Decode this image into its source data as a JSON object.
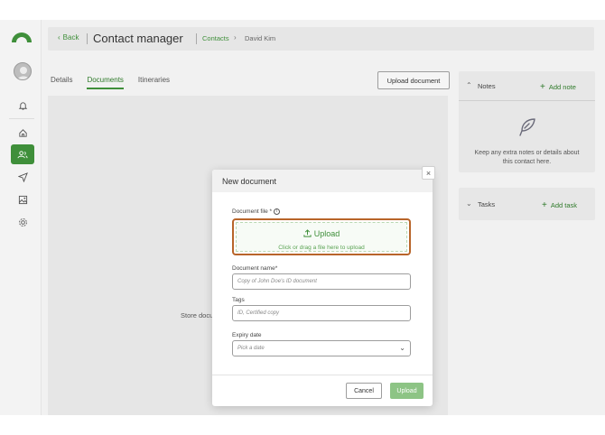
{
  "header": {
    "back_label": "Back",
    "title": "Contact manager",
    "breadcrumb": [
      "Contacts",
      "David Kim"
    ]
  },
  "tabs": [
    "Details",
    "Documents",
    "Itineraries"
  ],
  "active_tab": "Documents",
  "toolbar": {
    "upload_document_label": "Upload document"
  },
  "content": {
    "empty_text_visible": "Store docu"
  },
  "notes": {
    "title": "Notes",
    "add_label": "Add note",
    "empty_text": "Keep any extra notes or details about this contact here."
  },
  "tasks": {
    "title": "Tasks",
    "add_label": "Add task"
  },
  "sidebar": {
    "icons": [
      "logo",
      "avatar",
      "bell-icon",
      "home-icon",
      "contacts-icon",
      "send-icon",
      "image-icon",
      "settings-icon"
    ],
    "active": "contacts-icon"
  },
  "modal": {
    "title": "New document",
    "close_label": "×",
    "file_label": "Document file *",
    "upload_main": "Upload",
    "upload_sub": "Click or drag a file here to upload",
    "name_label": "Document name*",
    "name_placeholder": "Copy of John Doe's ID document",
    "tags_label": "Tags",
    "tags_placeholder": "ID, Certified copy",
    "expiry_label": "Expiry date",
    "expiry_placeholder": "Pick a date",
    "cancel_label": "Cancel",
    "submit_label": "Upload"
  },
  "colors": {
    "accent": "#3f8f3a",
    "highlight_border": "#b8652a",
    "submit_disabled": "#8dc485"
  }
}
